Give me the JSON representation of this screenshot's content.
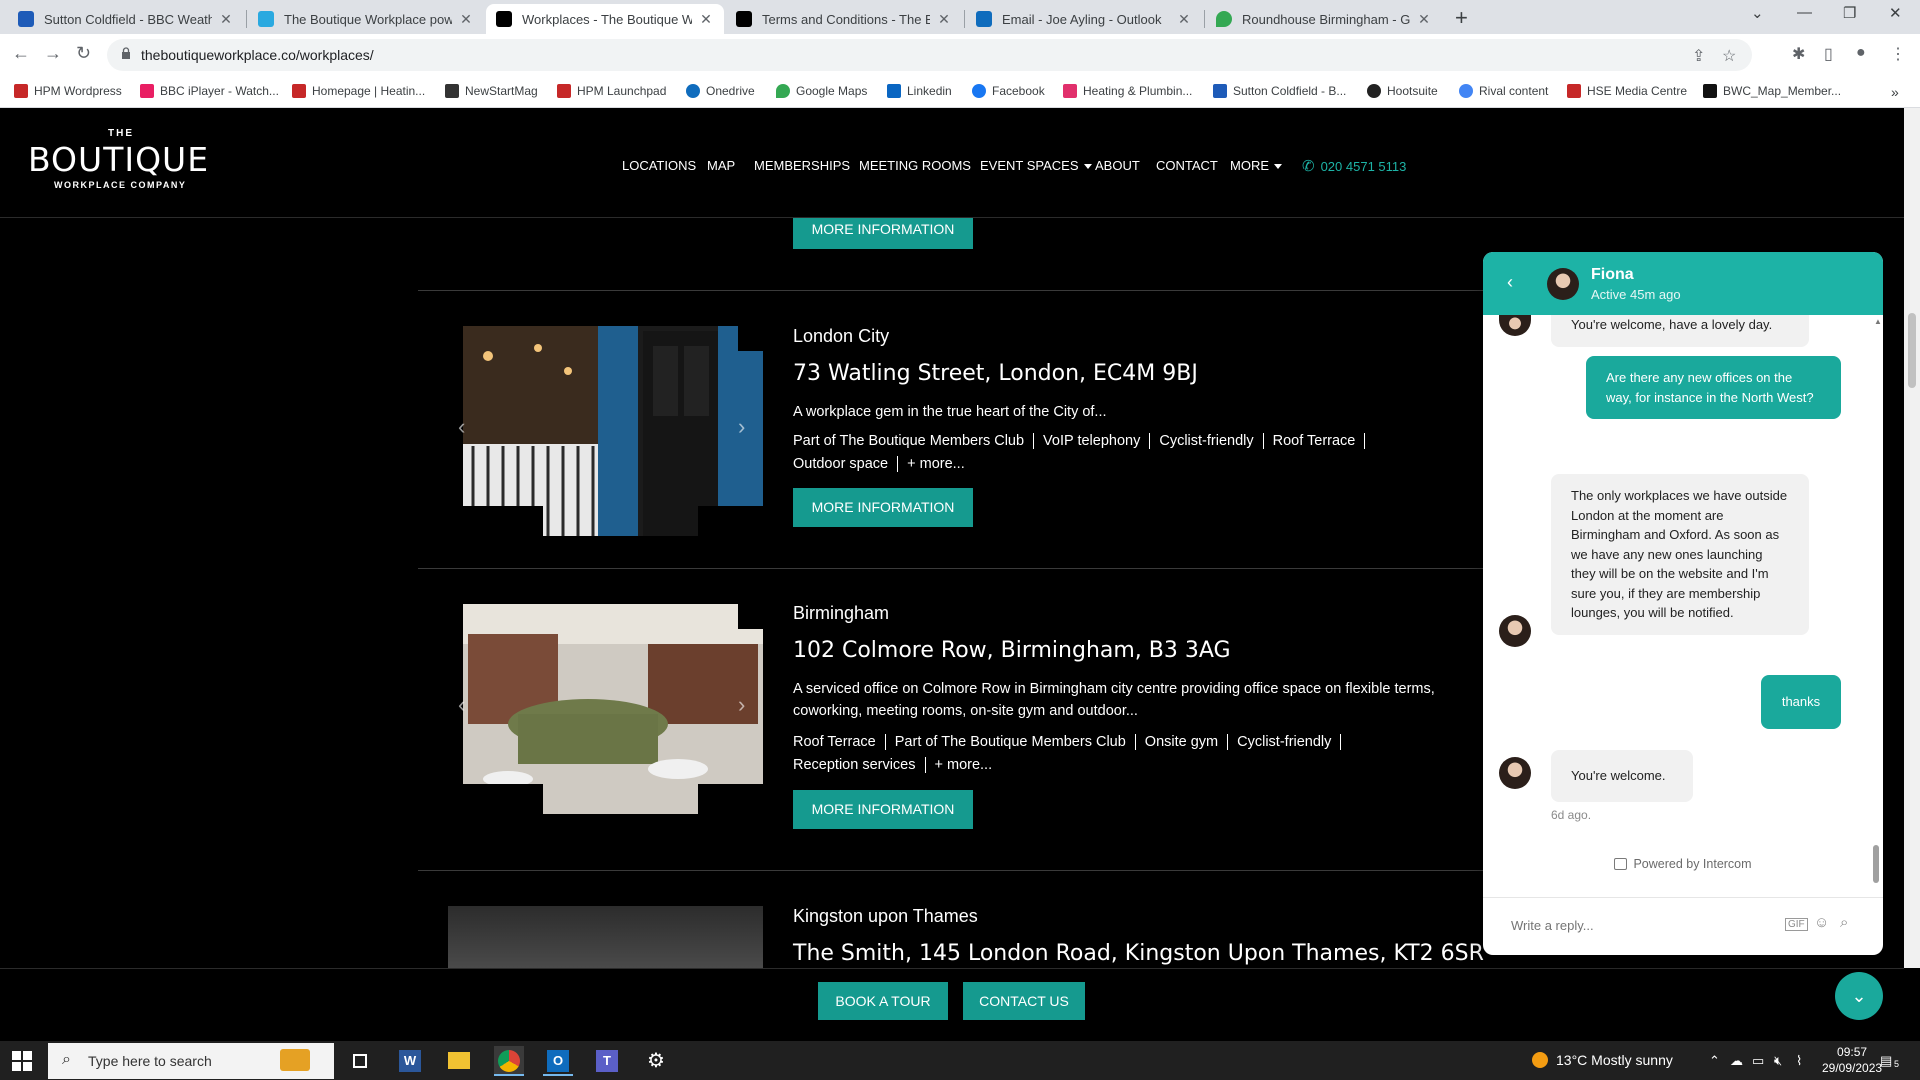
{
  "browser": {
    "tabs": [
      {
        "title": "Sutton Coldfield - BBC Weather",
        "favicon_color": "#1e5bb8"
      },
      {
        "title": "The Boutique Workplace powere",
        "favicon_color": "#2aa9e0"
      },
      {
        "title": "Workplaces - The Boutique Wor",
        "favicon_color": "#000000"
      },
      {
        "title": "Terms and Conditions - The Bou",
        "favicon_color": "#000000"
      },
      {
        "title": "Email - Joe Ayling - Outlook",
        "favicon_color": "#0f6cbd"
      },
      {
        "title": "Roundhouse Birmingham - Goo",
        "favicon_color": "#34a853"
      }
    ],
    "url": "theboutiqueworkplace.co/workplaces/",
    "bookmarks": [
      {
        "label": "HPM Wordpress",
        "color": "#c62828"
      },
      {
        "label": "BBC iPlayer - Watch...",
        "color": "#e91e63"
      },
      {
        "label": "Homepage | Heatin...",
        "color": "#c62828"
      },
      {
        "label": "NewStartMag",
        "color": "#333333"
      },
      {
        "label": "HPM Launchpad",
        "color": "#c62828"
      },
      {
        "label": "Onedrive",
        "color": "#0f6cbd"
      },
      {
        "label": "Google Maps",
        "color": "#34a853"
      },
      {
        "label": "Linkedin",
        "color": "#0a66c2"
      },
      {
        "label": "Facebook",
        "color": "#1877f2"
      },
      {
        "label": "Heating & Plumbin...",
        "color": "#e1306c"
      },
      {
        "label": "Sutton Coldfield - B...",
        "color": "#1e5bb8"
      },
      {
        "label": "Hootsuite",
        "color": "#222222"
      },
      {
        "label": "Rival content",
        "color": "#4285f4"
      },
      {
        "label": "HSE Media Centre",
        "color": "#c62828"
      },
      {
        "label": "BWC_Map_Member...",
        "color": "#111111"
      }
    ]
  },
  "site": {
    "logo": {
      "the": "THE",
      "main": "BOUTIQUE",
      "sub": "WORKPLACE COMPANY"
    },
    "nav": [
      "LOCATIONS",
      "MAP",
      "MEMBERSHIPS",
      "MEETING ROOMS",
      "EVENT SPACES",
      "ABOUT",
      "CONTACT",
      "MORE"
    ],
    "phone": "020 4571 5113",
    "more_button": "MORE INFORMATION",
    "listings": [
      {
        "city": "London City",
        "address": "73 Watling Street, London, EC4M 9BJ",
        "description": "A workplace gem in the true heart of the City of...",
        "tags_line1": [
          "Part of The Boutique Members Club",
          "VoIP telephony",
          "Cyclist-friendly",
          "Roof Terrace"
        ],
        "tags_line2": [
          "Outdoor space",
          "+ more..."
        ]
      },
      {
        "city": "Birmingham",
        "address": "102 Colmore Row, Birmingham, B3 3AG",
        "description": "A serviced office on Colmore Row in Birmingham city centre providing office space on flexible terms, coworking, meeting rooms, on-site gym and outdoor...",
        "tags_line1": [
          "Roof Terrace",
          "Part of The Boutique Members Club",
          "Onsite gym",
          "Cyclist-friendly"
        ],
        "tags_line2": [
          "Reception services",
          "+ more..."
        ]
      },
      {
        "city": "Kingston upon Thames",
        "address": "The Smith, 145 London Road, Kingston Upon Thames, KT2 6SR"
      }
    ],
    "cta": {
      "book": "BOOK A TOUR",
      "contact": "CONTACT US"
    },
    "accent": "#159a8f"
  },
  "chat": {
    "agent": "Fiona",
    "status": "Active 45m ago",
    "messages": [
      {
        "from": "agent",
        "text": "You're welcome, have a lovely day."
      },
      {
        "from": "user",
        "text": "Are there any new offices on the way, for instance in the North West?"
      },
      {
        "from": "agent",
        "text": "The only workplaces we have outside London at the moment are Birmingham and Oxford. As soon as we have any new ones launching they will be on the website and I'm sure you, if they are membership lounges, you will be notified."
      },
      {
        "from": "user",
        "text": "thanks"
      },
      {
        "from": "agent",
        "text": "You're welcome."
      }
    ],
    "timestamp": "6d ago.",
    "powered_by": "Powered by Intercom",
    "reply_placeholder": "Write a reply..."
  },
  "taskbar": {
    "search_placeholder": "Type here to search",
    "weather": "13°C  Mostly sunny",
    "time": "09:57",
    "date": "29/09/2023",
    "notification_count": "5"
  }
}
